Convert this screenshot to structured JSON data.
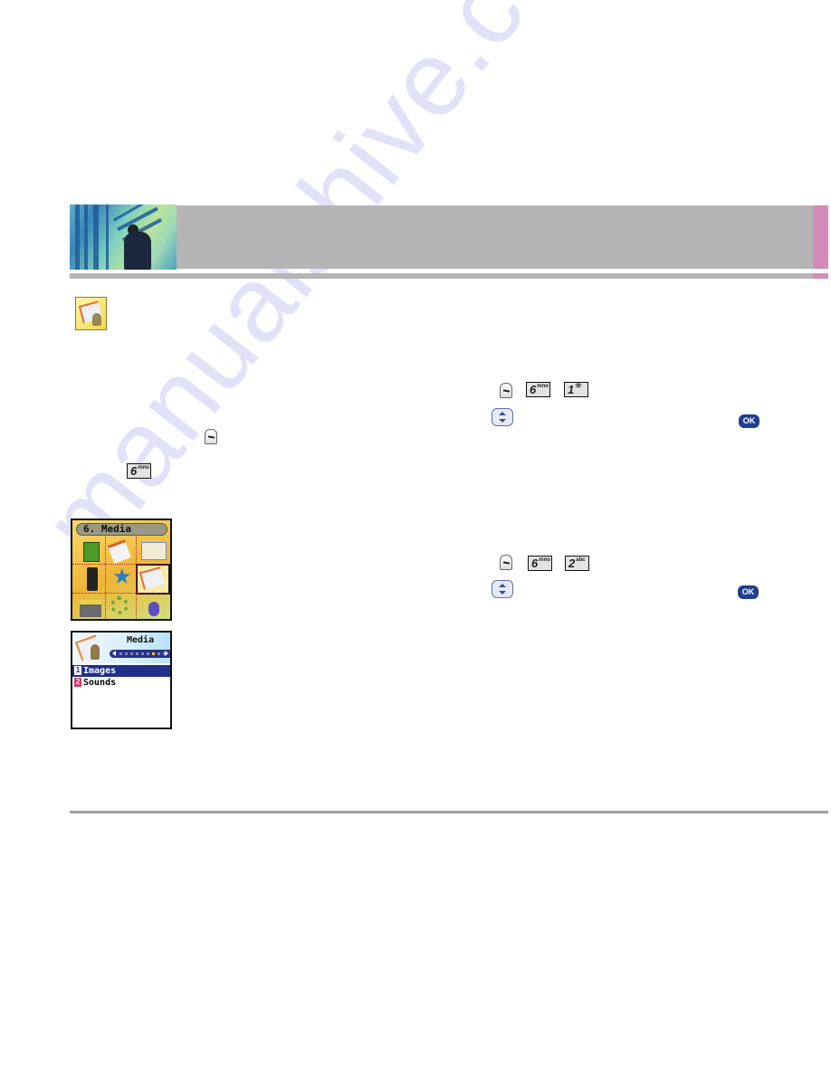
{
  "header": {
    "photo": "header-photo",
    "band_color": "#b5b5b5",
    "tab_color": "#d48bb7"
  },
  "section_icon": "media-menu-icon",
  "left_column_keys": [
    {
      "type": "softkey",
      "icon": "left-soft-key-icon"
    },
    {
      "type": "numkey",
      "digit": "6",
      "letters": "mno"
    }
  ],
  "screen_main_menu": {
    "title": "6. Media",
    "icons": [
      "contacts-icon",
      "calendar-icon",
      "messages-icon",
      "phone-icon",
      "favorites-star-icon",
      "media-icon",
      "toolbox-icon",
      "settings-gears-icon",
      "mouse-icon"
    ],
    "selected_index": 5
  },
  "screen_media_menu": {
    "title": "Media",
    "page_indicator": {
      "total": 9,
      "current": 7
    },
    "items": [
      {
        "number": "1",
        "label": "Images",
        "selected": true,
        "badge_color": "#1f2f8a"
      },
      {
        "number": "2",
        "label": "Sounds",
        "selected": false,
        "badge_color": "#d23a6b"
      }
    ]
  },
  "step_images": {
    "keys": [
      {
        "type": "softkey"
      },
      {
        "type": "numkey",
        "digit": "6",
        "letters": "mno"
      },
      {
        "type": "numkey",
        "digit": "1",
        "letters": "voicemail"
      }
    ],
    "nav": "navigation-key",
    "ok_label": "OK"
  },
  "step_sounds": {
    "keys": [
      {
        "type": "softkey"
      },
      {
        "type": "numkey",
        "digit": "6",
        "letters": "mno"
      },
      {
        "type": "numkey",
        "digit": "2",
        "letters": "abc"
      }
    ],
    "nav": "navigation-key",
    "ok_label": "OK"
  },
  "watermark": "manualshive.com"
}
